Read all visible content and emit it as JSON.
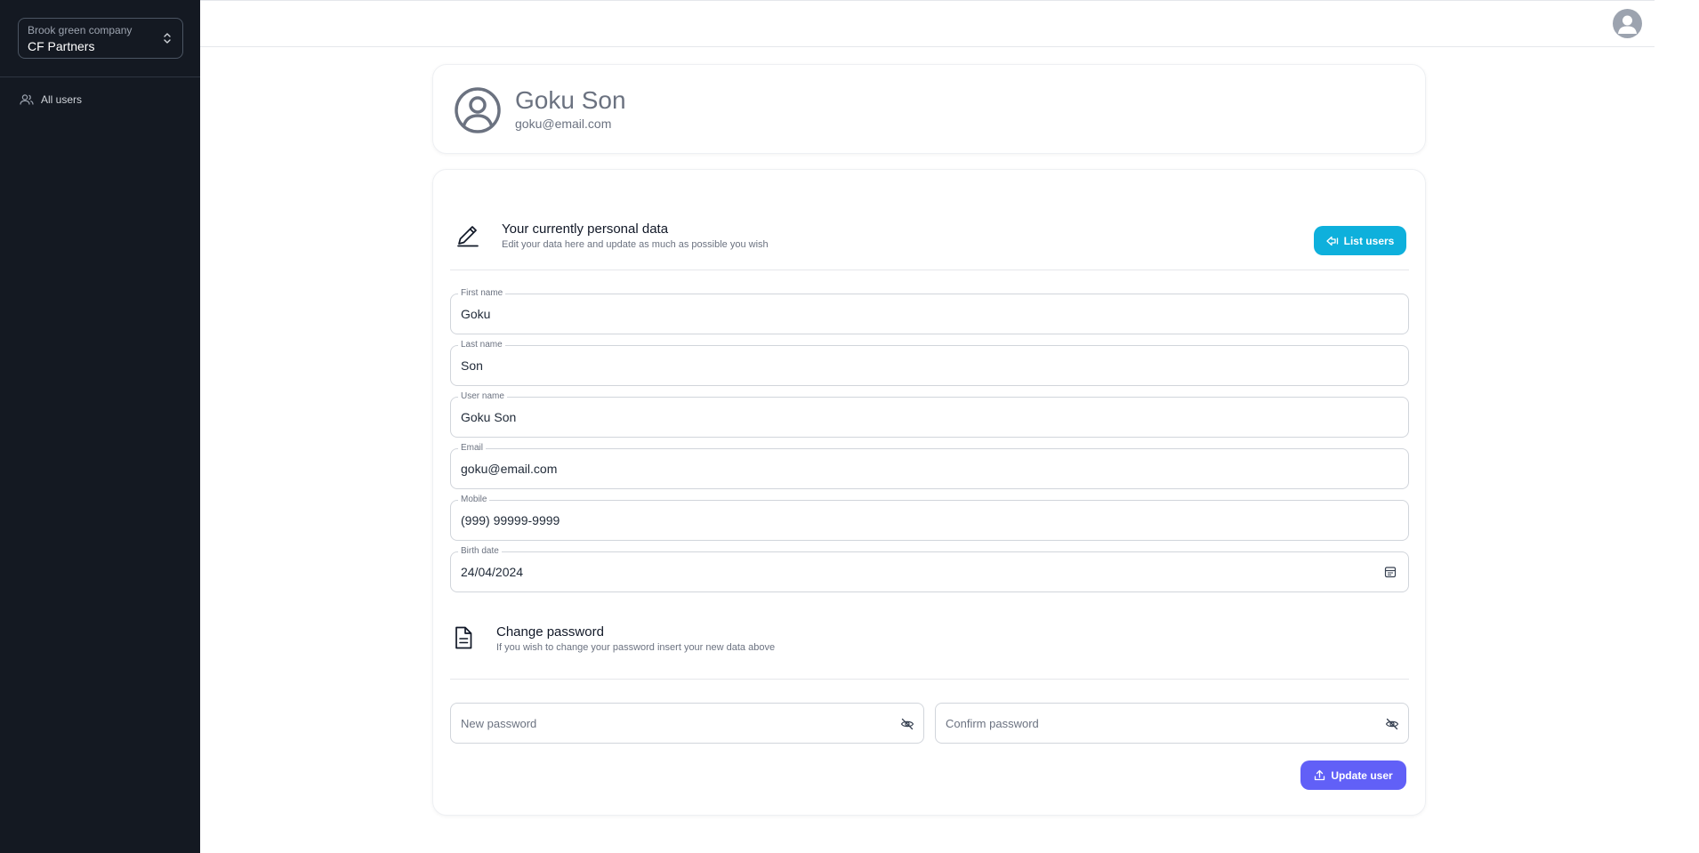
{
  "sidebar": {
    "company_caption": "Brook green company",
    "company_name": "CF Partners",
    "items": [
      {
        "label": "All users",
        "icon": "users-icon"
      }
    ]
  },
  "profile": {
    "name": "Goku Son",
    "email": "goku@email.com"
  },
  "personal": {
    "title": "Your currently personal data",
    "subtitle": "Edit your data here and update as much as possible you wish",
    "list_button": "List users",
    "fields": [
      {
        "label": "First name",
        "value": "Goku"
      },
      {
        "label": "Last name",
        "value": "Son"
      },
      {
        "label": "User name",
        "value": "Goku Son"
      },
      {
        "label": "Email",
        "value": "goku@email.com"
      },
      {
        "label": "Mobile",
        "value": "(999) 99999-9999"
      },
      {
        "label": "Birth date",
        "value": "24/04/2024"
      }
    ]
  },
  "password": {
    "title": "Change password",
    "subtitle": "If you wish to change your password insert your new data above",
    "new_placeholder": "New password",
    "confirm_placeholder": "Confirm password",
    "update_button": "Update user"
  },
  "colors": {
    "sidebar_bg": "#141922",
    "list_button": "#0eb0dc",
    "update_button": "#6160f7"
  }
}
